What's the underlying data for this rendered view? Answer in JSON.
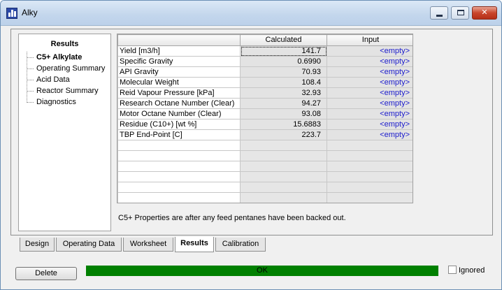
{
  "window": {
    "title": "Alky"
  },
  "nav": {
    "heading": "Results",
    "items": [
      {
        "label": "C5+ Alkylate",
        "active": true
      },
      {
        "label": "Operating Summary",
        "active": false
      },
      {
        "label": "Acid Data",
        "active": false
      },
      {
        "label": "Reactor Summary",
        "active": false
      },
      {
        "label": "Diagnostics",
        "active": false
      }
    ]
  },
  "grid": {
    "columns": [
      "",
      "Calculated",
      "Input"
    ],
    "rows": [
      {
        "name": "Yield [m3/h]",
        "calculated": "141.7",
        "input": "<empty>"
      },
      {
        "name": "Specific Gravity",
        "calculated": "0.6990",
        "input": "<empty>"
      },
      {
        "name": "API Gravity",
        "calculated": "70.93",
        "input": "<empty>"
      },
      {
        "name": "Molecular Weight",
        "calculated": "108.4",
        "input": "<empty>"
      },
      {
        "name": "Reid Vapour Pressure [kPa]",
        "calculated": "32.93",
        "input": "<empty>"
      },
      {
        "name": "Research Octane Number (Clear)",
        "calculated": "94.27",
        "input": "<empty>"
      },
      {
        "name": "Motor Octane Number (Clear)",
        "calculated": "93.08",
        "input": "<empty>"
      },
      {
        "name": "Residue (C10+) [wt %]",
        "calculated": "15.6883",
        "input": "<empty>"
      },
      {
        "name": "TBP End-Point [C]",
        "calculated": "223.7",
        "input": "<empty>"
      }
    ],
    "blank_rows": 6
  },
  "note": "C5+ Properties are after any feed pentanes have been backed out.",
  "tabs": [
    {
      "label": "Design",
      "active": false
    },
    {
      "label": "Operating Data",
      "active": false
    },
    {
      "label": "Worksheet",
      "active": false
    },
    {
      "label": "Results",
      "active": true
    },
    {
      "label": "Calibration",
      "active": false
    }
  ],
  "footer": {
    "delete_label": "Delete",
    "status_text": "OK",
    "status_color": "#008000",
    "ignored_label": "Ignored",
    "ignored_checked": false
  }
}
